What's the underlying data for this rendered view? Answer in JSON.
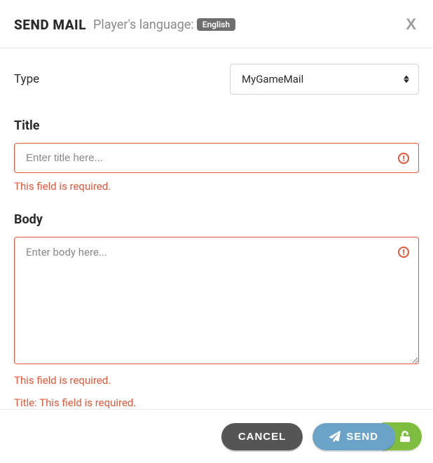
{
  "header": {
    "title": "SEND MAIL",
    "language_label": "Player's language:",
    "language_value": "English",
    "close_label": "X"
  },
  "fields": {
    "type": {
      "label": "Type",
      "selected": "MyGameMail"
    },
    "title": {
      "label": "Title",
      "placeholder": "Enter title here...",
      "error": "This field is required."
    },
    "body": {
      "label": "Body",
      "placeholder": "Enter body here...",
      "error": "This field is required."
    }
  },
  "summary_errors": [
    "Title: This field is required."
  ],
  "footer": {
    "cancel_label": "CANCEL",
    "send_label": "SEND"
  }
}
